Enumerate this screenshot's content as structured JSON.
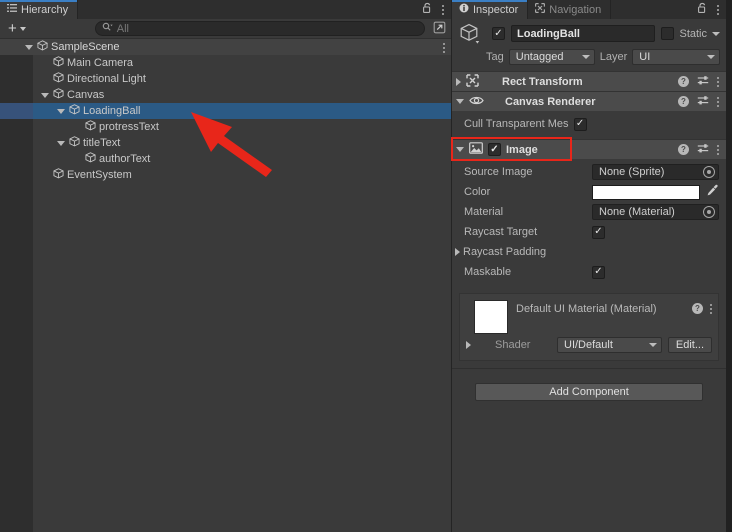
{
  "hierarchy": {
    "tab_label": "Hierarchy",
    "tab_icon": "hierarchy-icon",
    "lock_icon": "lock-open-icon",
    "menu_icon": "kebab-menu-icon",
    "toolbar": {
      "create_label": "+",
      "search_placeholder": "All",
      "search_value": "",
      "search_icon": "search-icon",
      "expand_icon": "open-in-new-icon"
    },
    "items": [
      {
        "label": "SampleScene",
        "depth": 0,
        "icon": "scene-icon",
        "foldout": "down",
        "selected": false,
        "is_scene": true
      },
      {
        "label": "Main Camera",
        "depth": 1,
        "icon": "gameobject-cube-icon",
        "foldout": "none",
        "selected": false,
        "is_scene": false
      },
      {
        "label": "Directional Light",
        "depth": 1,
        "icon": "gameobject-cube-icon",
        "foldout": "none",
        "selected": false,
        "is_scene": false
      },
      {
        "label": "Canvas",
        "depth": 1,
        "icon": "gameobject-cube-icon",
        "foldout": "down",
        "selected": false,
        "is_scene": false
      },
      {
        "label": "LoadingBall",
        "depth": 2,
        "icon": "gameobject-cube-icon",
        "foldout": "down",
        "selected": true,
        "is_scene": false
      },
      {
        "label": "protressText",
        "depth": 3,
        "icon": "gameobject-cube-icon",
        "foldout": "none",
        "selected": false,
        "is_scene": false
      },
      {
        "label": "titleText",
        "depth": 2,
        "icon": "gameobject-cube-icon",
        "foldout": "down",
        "selected": false,
        "is_scene": false
      },
      {
        "label": "authorText",
        "depth": 3,
        "icon": "gameobject-cube-icon",
        "foldout": "none",
        "selected": false,
        "is_scene": false
      },
      {
        "label": "EventSystem",
        "depth": 1,
        "icon": "gameobject-cube-icon",
        "foldout": "none",
        "selected": false,
        "is_scene": false
      }
    ]
  },
  "inspector": {
    "tabs": [
      {
        "label": "Inspector",
        "icon": "info-icon",
        "active": true
      },
      {
        "label": "Navigation",
        "icon": "navigation-icon",
        "active": false
      }
    ],
    "lock_icon": "lock-open-icon",
    "menu_icon": "kebab-menu-icon",
    "object_header": {
      "prefab_icon": "gameobject-cube-icon",
      "enabled": true,
      "name": "LoadingBall",
      "static_label": "Static",
      "static_checked": false,
      "tag_label": "Tag",
      "tag_value": "Untagged",
      "layer_label": "Layer",
      "layer_value": "UI"
    },
    "components": [
      {
        "title": "Rect Transform",
        "icon": "rect-transform-icon",
        "expanded": false,
        "has_toggle": false
      },
      {
        "title": "Canvas Renderer",
        "icon": "eye-icon",
        "expanded": true,
        "has_toggle": false
      },
      {
        "title": "Image",
        "icon": "image-icon",
        "expanded": true,
        "has_toggle": true,
        "toggle_checked": true,
        "highlighted": true
      }
    ],
    "canvas_renderer": {
      "cull_label": "Cull Transparent Mes",
      "cull_checked": true
    },
    "image": {
      "rows": [
        {
          "label": "Source Image",
          "type": "object",
          "value": "None (Sprite)"
        },
        {
          "label": "Color",
          "type": "color",
          "value": "#FFFFFF"
        },
        {
          "label": "Material",
          "type": "object",
          "value": "None (Material)"
        },
        {
          "label": "Raycast Target",
          "type": "check",
          "checked": true
        },
        {
          "label": "Raycast Padding",
          "type": "foldout"
        },
        {
          "label": "Maskable",
          "type": "check",
          "checked": true
        }
      ]
    },
    "material": {
      "title": "Default UI Material (Material)",
      "shader_label": "Shader",
      "shader_value": "UI/Default",
      "edit_label": "Edit...",
      "preview_color": "#FFFFFF",
      "help_icon": "help-icon",
      "menu_icon": "kebab-menu-icon"
    },
    "add_component_label": "Add Component"
  },
  "annotations": {
    "arrow_color": "#e8261a",
    "highlight_color": "#e8261a",
    "arrow_target": "LoadingBall",
    "highlight_target": "Image"
  }
}
